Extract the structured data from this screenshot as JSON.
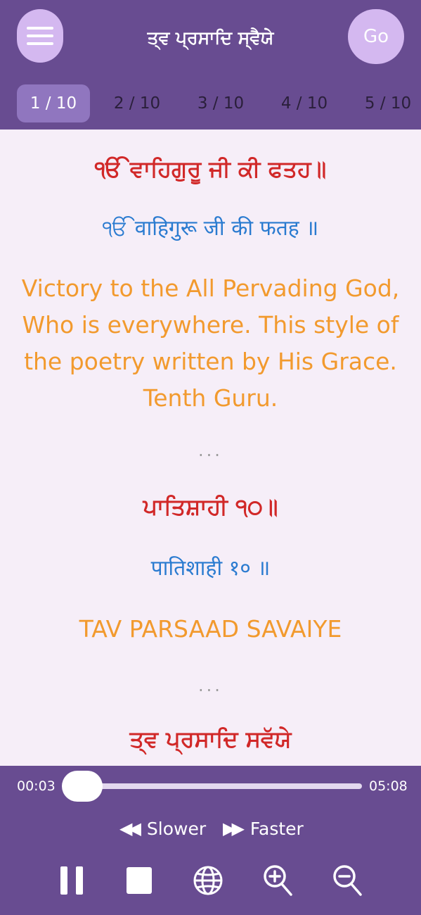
{
  "header": {
    "menu_icon": "hamburger-menu-icon",
    "title": "ਤ੍ਵ ਪ੍ਰਸਾਦਿ ਸ੍ਵੈਯੇ",
    "go_label": "Go",
    "tabs": [
      "1 / 10",
      "2 / 10",
      "3 / 10",
      "4 / 10",
      "5 / 10"
    ],
    "active_tab": "1 / 10"
  },
  "content": {
    "line1_gurmukhi": "ੴ ਵਾਹਿਗੁਰੂ ਜੀ ਕੀ ਫਤਹ॥",
    "line1_hindi": "ੴ वाहिगुरू जी की फतह ॥",
    "line1_english": "Victory to the All Pervading God, Who is everywhere. This style of the poetry written by His Grace. Tenth Guru.",
    "separator1": "...",
    "line2_gurmukhi": "ਪਾਤਿਸ਼ਾਹੀ ੧੦॥",
    "line2_hindi": "पातिशाही १० ॥",
    "line2_english": "TAV PARSAAD SAVAIYE",
    "separator2": "...",
    "line3_gurmukhi": "ਤ੍ਵ ਪ੍ਰਸਾਦਿ ਸਵੱਯੇ"
  },
  "player": {
    "elapsed": "00:03",
    "total": "05:08",
    "progress_fraction": 0.01,
    "slower_label": "Slower",
    "faster_label": "Faster",
    "rewind_icon": "rewind-icon",
    "fast_forward_icon": "fast-forward-icon",
    "controls": [
      "pause-icon",
      "stop-icon",
      "globe-icon",
      "zoom-in-icon",
      "zoom-out-icon"
    ]
  },
  "colors": {
    "header_bg": "#684c91",
    "button_bg": "#d4b8f0",
    "active_tab_bg": "#9076bf",
    "content_bg": "#f6eef8",
    "gurmukhi": "#d12828",
    "hindi": "#2a7bd0",
    "english": "#f29a2e"
  }
}
